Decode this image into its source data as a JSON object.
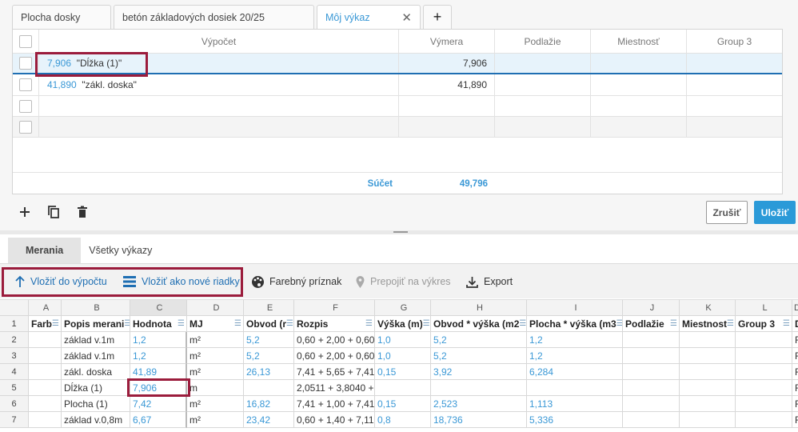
{
  "tabs": [
    {
      "label": "Plocha dosky"
    },
    {
      "label": "betón základových dosiek 20/25"
    },
    {
      "label": "Môj výkaz"
    },
    {
      "label": "+"
    }
  ],
  "top_grid": {
    "headers": {
      "calc": "Výpočet",
      "area": "Výmera",
      "floor": "Podlažie",
      "room": "Miestnosť",
      "group3": "Group 3"
    },
    "rows": [
      {
        "value": "7,906",
        "desc": "\"Dĺžka (1)\"",
        "area": "7,906"
      },
      {
        "value": "41,890",
        "desc": "\"zákl. doska\"",
        "area": "41,890"
      }
    ],
    "sum_label": "Súčet",
    "sum_value": "49,796"
  },
  "buttons": {
    "cancel": "Zrušiť",
    "save": "Uložiť"
  },
  "lower_tabs": [
    "Merania",
    "Všetky výkazy"
  ],
  "toolbar": {
    "insert_calc": "Vložiť do výpočtu",
    "insert_rows": "Vložiť ako nové riadky",
    "color_flag": "Farebný príznak",
    "link_drawing": "Prepojiť na výkres",
    "export": "Export"
  },
  "sheet": {
    "col_letters": [
      "A",
      "B",
      "C",
      "D",
      "E",
      "F",
      "G",
      "H",
      "I",
      "J",
      "K",
      "L",
      "D"
    ],
    "headers": [
      "Farb",
      "Popis merani",
      "Hodnota",
      "MJ",
      "Obvod (r",
      "Rozpis",
      "Výška (m)",
      "Obvod * výška (m2",
      "Plocha * výška (m3",
      "Podlažie",
      "Miestnost",
      "Group 3",
      "D"
    ],
    "rows": [
      {
        "n": "2",
        "cells": [
          "",
          "základ v.1m",
          "1,2",
          "m²",
          "5,2",
          "0,60 + 2,00 + 0,60",
          "1,0",
          "5,2",
          "1,2",
          "",
          "",
          "",
          "F"
        ]
      },
      {
        "n": "3",
        "cells": [
          "",
          "základ v.1m",
          "1,2",
          "m²",
          "5,2",
          "0,60 + 2,00 + 0,60",
          "1,0",
          "5,2",
          "1,2",
          "",
          "",
          "",
          "F"
        ]
      },
      {
        "n": "4",
        "cells": [
          "",
          "zákl. doska",
          "41,89",
          "m²",
          "26,13",
          "7,41 + 5,65 + 7,41",
          "0,15",
          "3,92",
          "6,284",
          "",
          "",
          "",
          "F"
        ]
      },
      {
        "n": "5",
        "cells": [
          "",
          "Dĺžka (1)",
          "7,906",
          "m",
          "",
          "2,0511 + 3,8040 +",
          "",
          "",
          "",
          "",
          "",
          "",
          "F"
        ]
      },
      {
        "n": "6",
        "cells": [
          "",
          "Plocha (1)",
          "7,42",
          "m²",
          "16,82",
          "7,41 + 1,00 + 7,41",
          "0,15",
          "2,523",
          "1,113",
          "",
          "",
          "",
          "F"
        ]
      },
      {
        "n": "7",
        "cells": [
          "",
          "základ v.0,8m",
          "6,67",
          "m²",
          "23,42",
          "0,60 + 1,40 + 7,11",
          "0,8",
          "18,736",
          "5,336",
          "",
          "",
          "",
          "F"
        ]
      }
    ]
  }
}
